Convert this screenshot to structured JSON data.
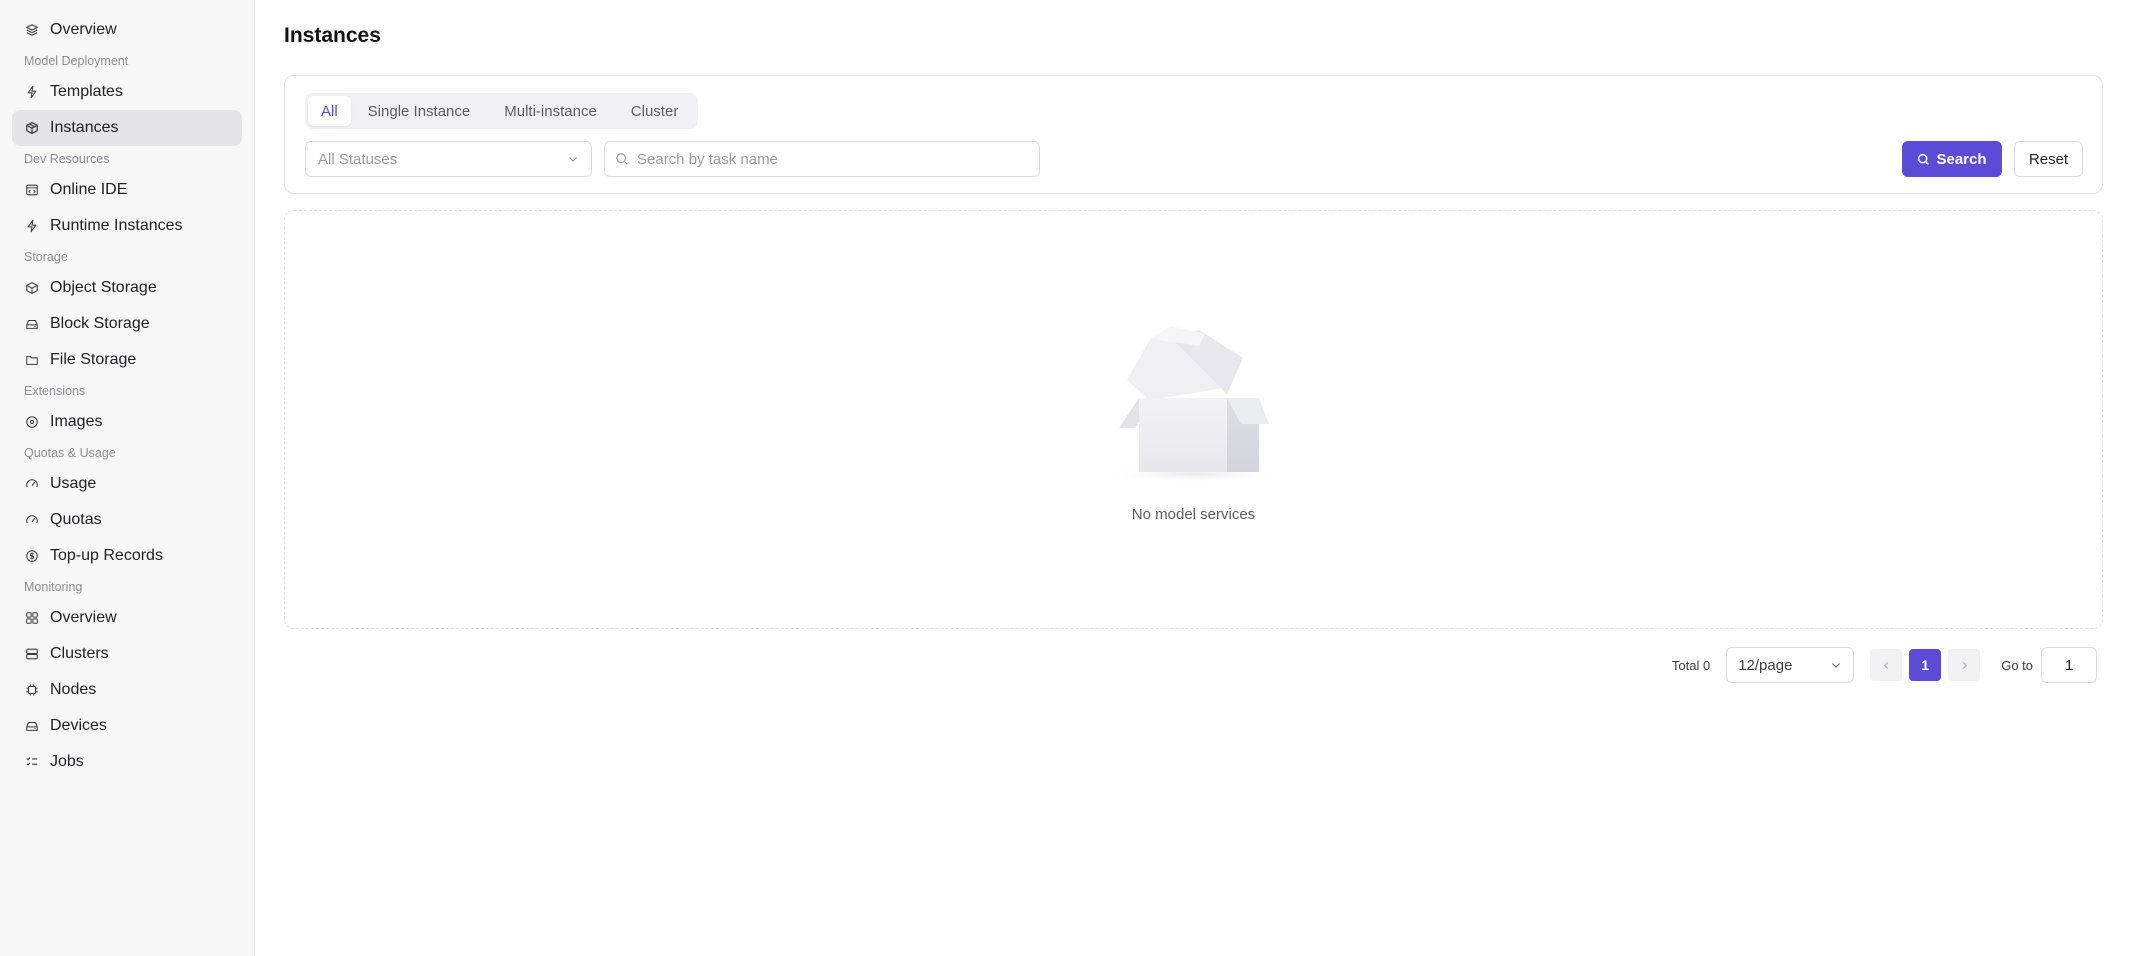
{
  "sidebar": {
    "items": [
      {
        "type": "item",
        "label": "Overview",
        "icon": "layers-icon",
        "name": "sidebar-item-overview"
      },
      {
        "type": "group",
        "label": "Model Deployment"
      },
      {
        "type": "item",
        "label": "Templates",
        "icon": "lightning-icon",
        "name": "sidebar-item-templates"
      },
      {
        "type": "item",
        "label": "Instances",
        "icon": "package-icon",
        "name": "sidebar-item-instances",
        "active": true
      },
      {
        "type": "group",
        "label": "Dev Resources"
      },
      {
        "type": "item",
        "label": "Online IDE",
        "icon": "code-window-icon",
        "name": "sidebar-item-online-ide"
      },
      {
        "type": "item",
        "label": "Runtime Instances",
        "icon": "lightning-icon",
        "name": "sidebar-item-runtime-instances"
      },
      {
        "type": "group",
        "label": "Storage"
      },
      {
        "type": "item",
        "label": "Object Storage",
        "icon": "cube-icon",
        "name": "sidebar-item-object-storage"
      },
      {
        "type": "item",
        "label": "Block Storage",
        "icon": "drive-icon",
        "name": "sidebar-item-block-storage"
      },
      {
        "type": "item",
        "label": "File Storage",
        "icon": "folder-icon",
        "name": "sidebar-item-file-storage"
      },
      {
        "type": "group",
        "label": "Extensions"
      },
      {
        "type": "item",
        "label": "Images",
        "icon": "disc-icon",
        "name": "sidebar-item-images"
      },
      {
        "type": "group",
        "label": "Quotas & Usage"
      },
      {
        "type": "item",
        "label": "Usage",
        "icon": "gauge-icon",
        "name": "sidebar-item-usage"
      },
      {
        "type": "item",
        "label": "Quotas",
        "icon": "gauge-icon",
        "name": "sidebar-item-quotas"
      },
      {
        "type": "item",
        "label": "Top-up Records",
        "icon": "dollar-icon",
        "name": "sidebar-item-top-up-records"
      },
      {
        "type": "group",
        "label": "Monitoring"
      },
      {
        "type": "item",
        "label": "Overview",
        "icon": "dashboard-icon",
        "name": "sidebar-item-monitoring-overview"
      },
      {
        "type": "item",
        "label": "Clusters",
        "icon": "server-icon",
        "name": "sidebar-item-clusters"
      },
      {
        "type": "item",
        "label": "Nodes",
        "icon": "chip-icon",
        "name": "sidebar-item-nodes"
      },
      {
        "type": "item",
        "label": "Devices",
        "icon": "drive-icon",
        "name": "sidebar-item-devices"
      },
      {
        "type": "item",
        "label": "Jobs",
        "icon": "checklist-icon",
        "name": "sidebar-item-jobs"
      }
    ]
  },
  "page": {
    "title": "Instances"
  },
  "filters": {
    "tabs": [
      "All",
      "Single Instance",
      "Multi-instance",
      "Cluster"
    ],
    "active_tab": 0,
    "status_select": {
      "placeholder": "All Statuses"
    },
    "search": {
      "placeholder": "Search by task name",
      "value": ""
    },
    "search_button": "Search",
    "reset_button": "Reset"
  },
  "empty_state": {
    "message": "No model services"
  },
  "pagination": {
    "total_label": "Total 0",
    "page_size": "12/page",
    "current_page": "1",
    "goto_label": "Go to",
    "goto_value": "1"
  },
  "colors": {
    "accent": "#5b4bd6",
    "sidebar_bg": "#f7f7f8",
    "active_item_bg": "#e4e4e7"
  }
}
